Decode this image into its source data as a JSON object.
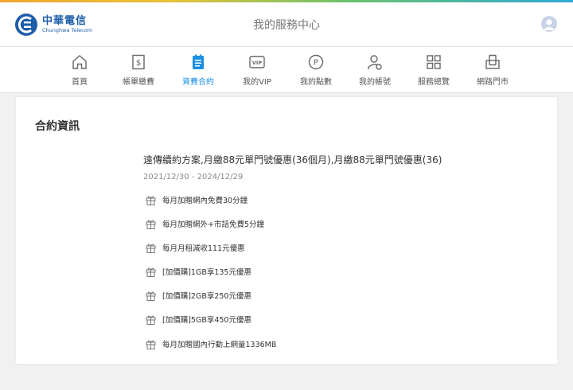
{
  "brand": {
    "name_cn": "中華電信",
    "name_en": "Chunghwa Telecom",
    "color": "#1c5ea8"
  },
  "header": {
    "title": "我的服務中心"
  },
  "colors": {
    "accent": "#1a8fe3",
    "nav_icon": "#666666"
  },
  "nav": [
    {
      "label": "首頁",
      "icon": "home-icon"
    },
    {
      "label": "帳單繳費",
      "icon": "bill-icon"
    },
    {
      "label": "資費合約",
      "icon": "contract-icon",
      "active": true
    },
    {
      "label": "我的VIP",
      "icon": "vip-icon"
    },
    {
      "label": "我的點數",
      "icon": "points-icon"
    },
    {
      "label": "我的帳號",
      "icon": "account-icon"
    },
    {
      "label": "服務總覽",
      "icon": "grid-icon"
    },
    {
      "label": "網路門市",
      "icon": "shop-icon"
    }
  ],
  "contract": {
    "section_title": "合約資訊",
    "plan_name": "遠傳續約方案,月繳88元單門號優惠(36個月),月繳88元單門號優惠(36)",
    "period": "2021/12/30 - 2024/12/29",
    "benefits": [
      "每月加贈網內免費30分鐘",
      "每月加贈網外+市話免費5分鐘",
      "每月月租減收111元優惠",
      "[加價購]1GB享135元優惠",
      "[加價購]2GB享250元優惠",
      "[加價購]5GB享450元優惠",
      "每月加贈國內行動上網量1336MB"
    ],
    "benefit_icon": "gift-icon"
  }
}
